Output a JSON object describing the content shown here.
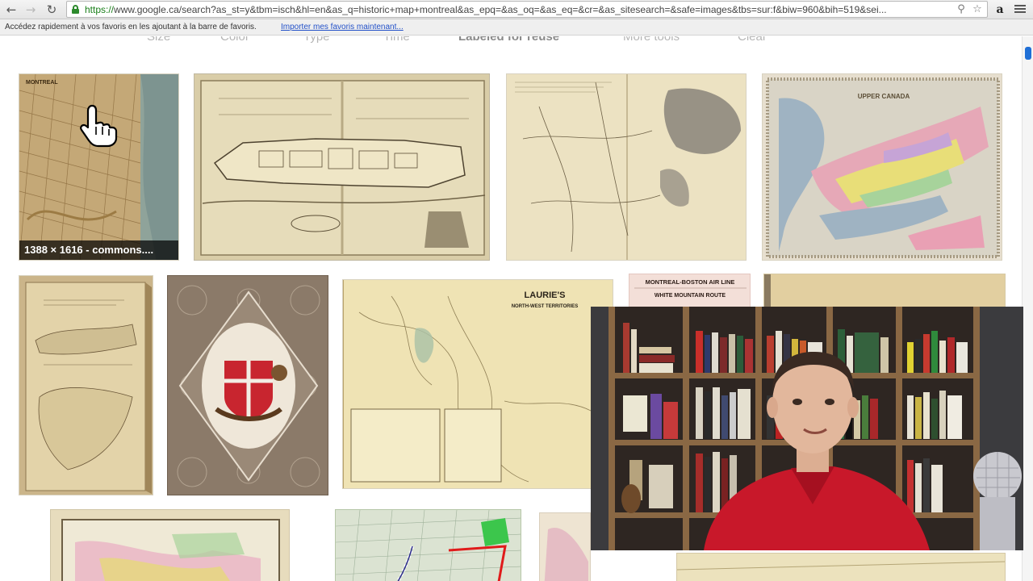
{
  "browser": {
    "back_icon": "back-arrow-icon",
    "forward_icon": "forward-arrow-icon",
    "reload_icon": "reload-icon",
    "url_scheme": "https://",
    "url_rest": "www.google.ca/search?as_st=y&tbm=isch&hl=en&as_q=historic+map+montreal&as_epq=&as_oq=&as_eq=&cr=&as_sitesearch=&safe=images&tbs=sur:f&biw=960&bih=519&sei...",
    "zoom_icon": "magnifier-icon",
    "star_icon": "star-icon",
    "extension_icon": "amazon-icon",
    "menu_icon": "hamburger-menu-icon"
  },
  "bookmarks_bar": {
    "message": "Accédez rapidement à vos favoris en les ajoutant à la barre de favoris.",
    "import_link": "Importer mes favoris maintenant..."
  },
  "search_tools": {
    "items": [
      {
        "label": "Size",
        "active": false
      },
      {
        "label": "Color",
        "active": false
      },
      {
        "label": "Type",
        "active": false
      },
      {
        "label": "Time",
        "active": false
      },
      {
        "label": "Labeled for reuse",
        "active": true
      },
      {
        "label": "More tools",
        "active": false
      },
      {
        "label": "Clear",
        "active": false
      }
    ]
  },
  "results": {
    "hover_caption": "1388 × 1616 - commons....",
    "thumb_titles": {
      "montreal_map": "MONTREAL",
      "upper_canada": "UPPER CANADA",
      "laurie": "LAURIE'S",
      "laurie_sub": "NORTH-WEST TERRITORIES",
      "air_line": "MONTREAL-BOSTON AIR LINE",
      "white_mountain": "WHITE MOUNTAIN ROUTE"
    }
  },
  "cursor_icon": "hand-pointer-icon",
  "webcam_label": "webcam-overlay",
  "colors": {
    "accent_link": "#2250c8",
    "secure_green": "#1a7f1a",
    "scroll_thumb": "#1f6fd6",
    "shirt_red": "#c8182a"
  }
}
